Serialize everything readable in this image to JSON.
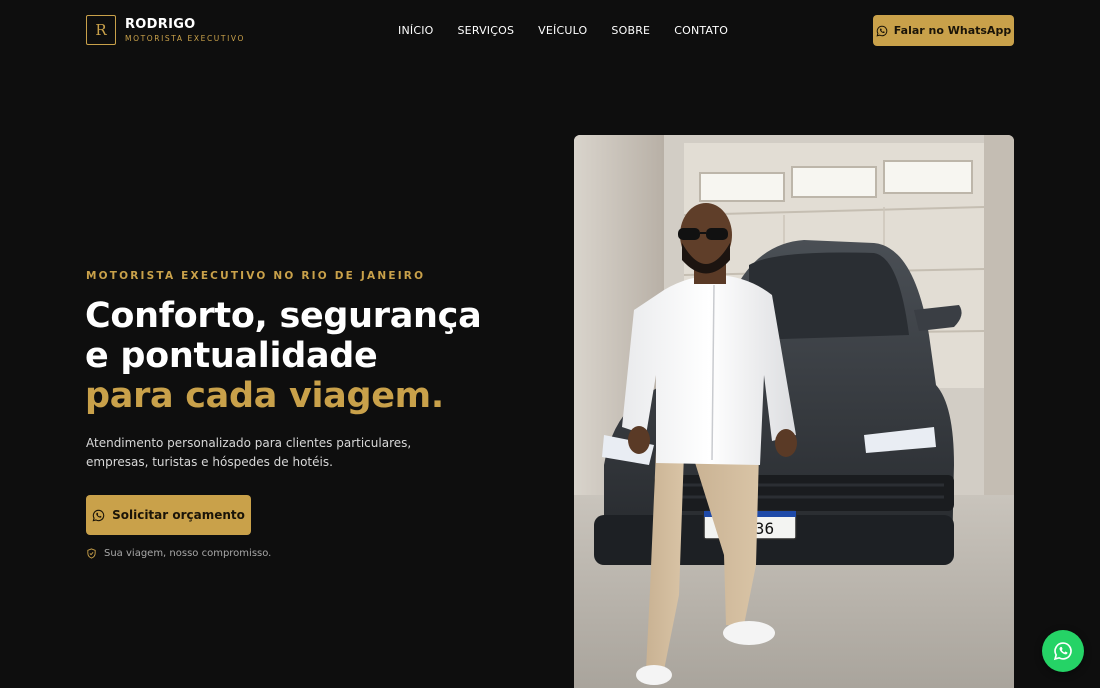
{
  "brand": {
    "mark": "R",
    "name": "RODRIGO",
    "subtitle": "MOTORISTA EXECUTIVO"
  },
  "nav": {
    "items": [
      "INÍCIO",
      "SERVIÇOS",
      "VEÍCULO",
      "SOBRE",
      "CONTATO"
    ]
  },
  "header_cta": {
    "label": "Falar no WhatsApp",
    "icon": "whatsapp-icon"
  },
  "hero": {
    "eyebrow": "MOTORISTA EXECUTIVO NO RIO DE JANEIRO",
    "headline_line1": "Conforto, segurança",
    "headline_line2": "e pontualidade",
    "headline_line3": "para cada viagem.",
    "description_line1": "Atendimento personalizado para clientes particulares,",
    "description_line2": "empresas, turistas e hóspedes de hotéis.",
    "cta_label": "Solicitar orçamento",
    "tagline": "Sua viagem, nosso compromisso."
  },
  "photo": {
    "plate_text": "T 036"
  },
  "colors": {
    "accent": "#c9a14a",
    "background": "#0e0e0e",
    "whatsapp": "#25d366"
  }
}
